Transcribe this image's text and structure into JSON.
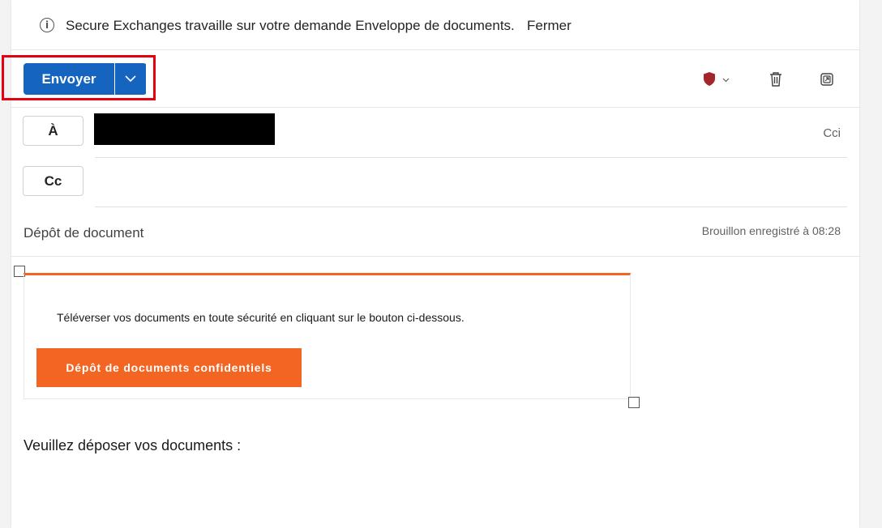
{
  "infobar": {
    "message": "Secure Exchanges travaille sur votre demande Enveloppe de documents.",
    "close_label": "Fermer",
    "icon": "info-icon"
  },
  "toolbar": {
    "send_label": "Envoyer",
    "icons": [
      "send-options-chevron-icon",
      "sensitivity-shield-icon",
      "delete-icon",
      "popout-icon"
    ],
    "shield_color": "#a4262c",
    "accent": "#1565c0"
  },
  "recipients": {
    "to_label": "À",
    "cc_label": "Cc",
    "bcc_label": "Cci"
  },
  "subject": {
    "text": "Dépôt de document",
    "draft_status": "Brouillon enregistré à 08:28"
  },
  "card": {
    "text": "Téléverser vos documents en toute sécurité en cliquant sur le bouton ci-dessous.",
    "button_label": "Dépôt de documents confidentiels",
    "accent": "#f26522"
  },
  "body": {
    "text": "Veuillez déposer vos documents :"
  }
}
